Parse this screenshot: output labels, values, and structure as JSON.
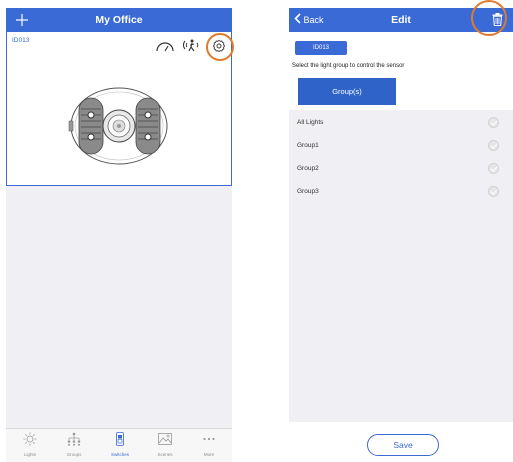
{
  "colors": {
    "accent": "#3a6ad6",
    "highlight": "#e07a2c",
    "background_gray": "#efeff4"
  },
  "left_screen": {
    "navbar": {
      "add_icon": "plus-icon",
      "title": "My Office"
    },
    "device_card": {
      "device_id": "ID013",
      "icons": [
        "sensitivity-icon",
        "motion-sensor-icon",
        "settings-icon"
      ],
      "device_image": "motion-sensor-device"
    },
    "tabbar": {
      "tabs": [
        {
          "label": "Lights",
          "icon": "light-icon"
        },
        {
          "label": "Groups",
          "icon": "groups-icon"
        },
        {
          "label": "Switches",
          "icon": "switch-icon",
          "active": true
        },
        {
          "label": "Scenes",
          "icon": "scene-icon"
        },
        {
          "label": "More",
          "icon": "more-icon"
        }
      ]
    }
  },
  "right_screen": {
    "navbar": {
      "back_label": "Back",
      "title": "Edit",
      "trash_icon": "trash-icon"
    },
    "device_id": "ID013",
    "instruction": "Select the light group to control the sensor",
    "group_button": "Group(s)",
    "list": [
      {
        "label": "All Lights"
      },
      {
        "label": "Group1"
      },
      {
        "label": "Group2"
      },
      {
        "label": "Group3"
      }
    ],
    "save_label": "Save"
  }
}
